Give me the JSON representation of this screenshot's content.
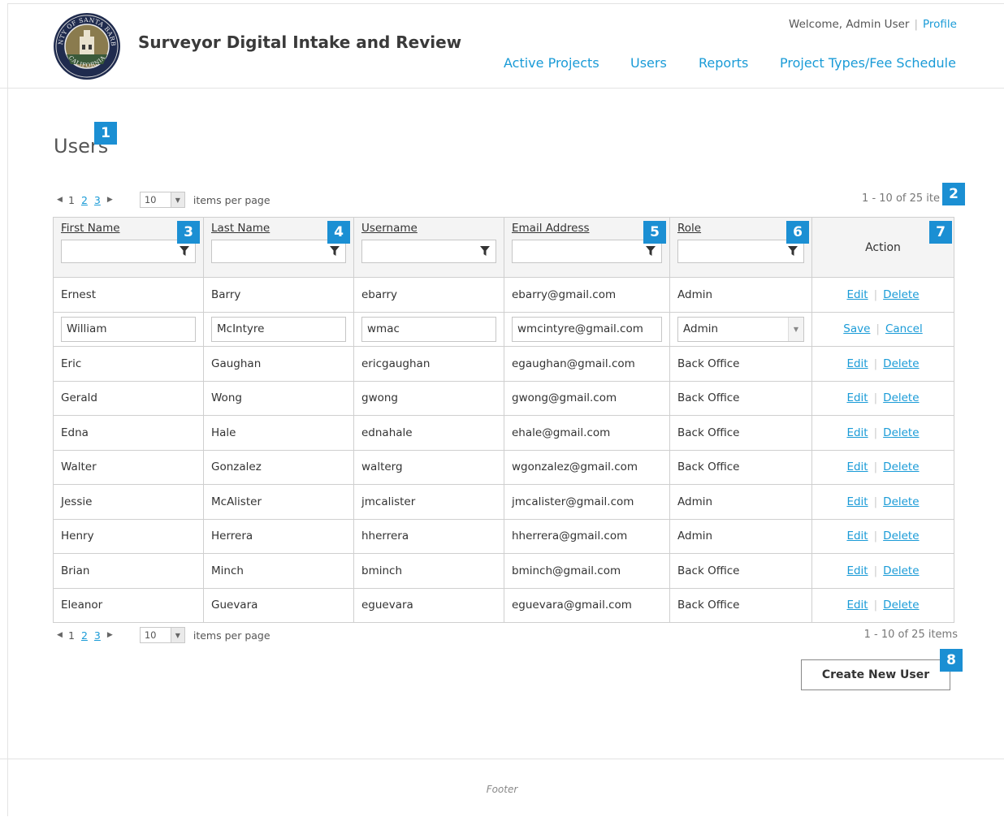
{
  "header": {
    "app_title": "Surveyor Digital Intake and Review",
    "logo_text_top": "COUNTY OF SANTA BARBARA",
    "logo_text_bottom": "CALIFORNIA",
    "welcome": "Welcome, Admin User",
    "profile_link": "Profile",
    "nav": [
      "Active Projects",
      "Users",
      "Reports",
      "Project Types/Fee Schedule"
    ]
  },
  "page": {
    "title": "Users"
  },
  "pager_top": {
    "pages": [
      "1",
      "2",
      "3"
    ],
    "page_size": "10",
    "items_per_page_label": "items per page",
    "count_text": "1 - 10 of 25 ite"
  },
  "pager_bottom": {
    "pages": [
      "1",
      "2",
      "3"
    ],
    "page_size": "10",
    "items_per_page_label": "items per page",
    "count_text": "1 - 10 of 25 items"
  },
  "table": {
    "columns": [
      "First Name",
      "Last Name",
      "Username",
      "Email Address",
      "Role",
      "Action"
    ],
    "rows": [
      [
        "Ernest",
        "Barry",
        "ebarry",
        "ebarry@gmail.com",
        "Admin"
      ],
      [
        "William",
        "McIntyre",
        "wmac",
        "wmcintyre@gmail.com",
        "Admin"
      ],
      [
        "Eric",
        "Gaughan",
        "ericgaughan",
        "egaughan@gmail.com",
        "Back Office"
      ],
      [
        "Gerald",
        "Wong",
        "gwong",
        "gwong@gmail.com",
        "Back Office"
      ],
      [
        "Edna",
        "Hale",
        "ednahale",
        "ehale@gmail.com",
        "Back Office"
      ],
      [
        "Walter",
        "Gonzalez",
        "walterg",
        "wgonzalez@gmail.com",
        "Back Office"
      ],
      [
        "Jessie",
        "McAlister",
        "jmcalister",
        "jmcalister@gmail.com",
        "Admin"
      ],
      [
        "Henry",
        "Herrera",
        "hherrera",
        "hherrera@gmail.com",
        "Admin"
      ],
      [
        "Brian",
        "Minch",
        "bminch",
        "bminch@gmail.com",
        "Back Office"
      ],
      [
        "Eleanor",
        "Guevara",
        "eguevara",
        "eguevara@gmail.com",
        "Back Office"
      ]
    ],
    "row_actions": {
      "edit": "Edit",
      "delete": "Delete"
    },
    "edit_actions": {
      "save": "Save",
      "cancel": "Cancel"
    }
  },
  "create_button": "Create New User",
  "callouts": [
    "1",
    "2",
    "3",
    "4",
    "5",
    "6",
    "7",
    "8"
  ],
  "footer": "Footer",
  "colors": {
    "link": "#1a9bd7",
    "callout": "#1b8fd3"
  },
  "icons": [
    "county-seal-logo",
    "filter-icon",
    "arrow-left-icon",
    "arrow-right-icon",
    "dropdown-arrow-icon"
  ]
}
